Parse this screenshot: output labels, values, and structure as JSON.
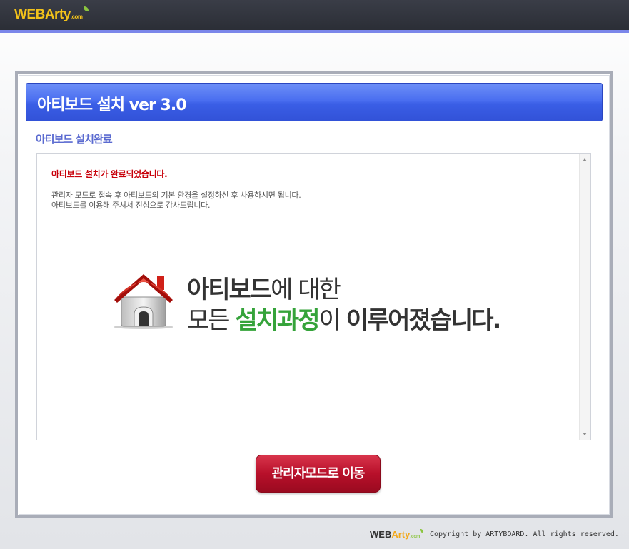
{
  "header": {
    "logo_main": "WEBArty",
    "logo_domain": ".com"
  },
  "installer": {
    "title": "아티보드 설치  ver 3.0",
    "subtitle": "아티보드 설치완료",
    "message_title": "아티보드 설치가 완료되었습니다.",
    "message_lines": [
      "관리자 모드로 접속 후 아티보드의 기본 환경을 설정하신 후 사용하시면 됩니다.",
      "아티보드를 이용해 주셔서 진심으로 감사드립니다."
    ],
    "banner": {
      "line1_bold": "아티보드",
      "line1_rest": "에 대한",
      "line2_pre": "모든 ",
      "line2_green": "설치과정",
      "line2_mid": "이 ",
      "line2_bold": "이루어졌습니다."
    },
    "admin_button_label": "관리자모드로 이동"
  },
  "footer": {
    "logo_web": "WEB",
    "logo_arty": "Arty",
    "logo_domain": ".com",
    "copyright": "Copyright by ARTYBOARD. All rights reserved."
  },
  "colors": {
    "title_bar": "#4a6ef0",
    "subtitle": "#5a6ad0",
    "message_title": "#c8000a",
    "accent_green": "#35a33a",
    "admin_button": "#b8102a",
    "logo_yellow": "#f2c21a"
  },
  "icons": [
    "house-icon",
    "scroll-up-icon",
    "scroll-down-icon",
    "leaf-icon"
  ]
}
